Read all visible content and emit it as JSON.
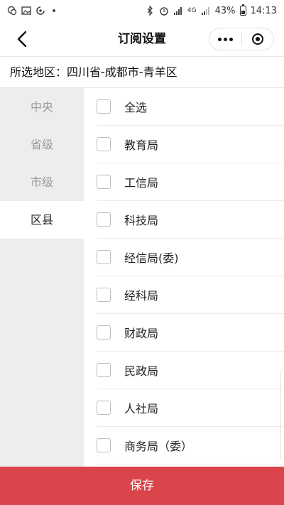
{
  "status_bar": {
    "signal_text": "4G",
    "battery_percent": "43%",
    "time": "14:13",
    "icons": [
      "wechat-icon",
      "image-icon",
      "sync-icon",
      "bluetooth-icon",
      "alarm-icon",
      "signal-icon",
      "battery-icon"
    ]
  },
  "navbar": {
    "title": "订阅设置",
    "icons": [
      "back-arrow-icon",
      "more-dots-icon",
      "close-target-icon"
    ]
  },
  "region": {
    "label": "所选地区：",
    "value": "四川省-成都市-青羊区"
  },
  "categories": [
    {
      "label": "中央",
      "active": false
    },
    {
      "label": "省级",
      "active": false
    },
    {
      "label": "市级",
      "active": false
    },
    {
      "label": "区县",
      "active": true
    }
  ],
  "items": [
    {
      "label": "全选",
      "checked": false
    },
    {
      "label": "教育局",
      "checked": false
    },
    {
      "label": "工信局",
      "checked": false
    },
    {
      "label": "科技局",
      "checked": false
    },
    {
      "label": "经信局(委)",
      "checked": false
    },
    {
      "label": "经科局",
      "checked": false
    },
    {
      "label": "财政局",
      "checked": false
    },
    {
      "label": "民政局",
      "checked": false
    },
    {
      "label": "人社局",
      "checked": false
    },
    {
      "label": "商务局（委）",
      "checked": false
    }
  ],
  "save_button": {
    "label": "保存"
  },
  "colors": {
    "accent": "#d9454a",
    "sidebar_bg": "#ededed",
    "inactive_text": "#999999"
  }
}
